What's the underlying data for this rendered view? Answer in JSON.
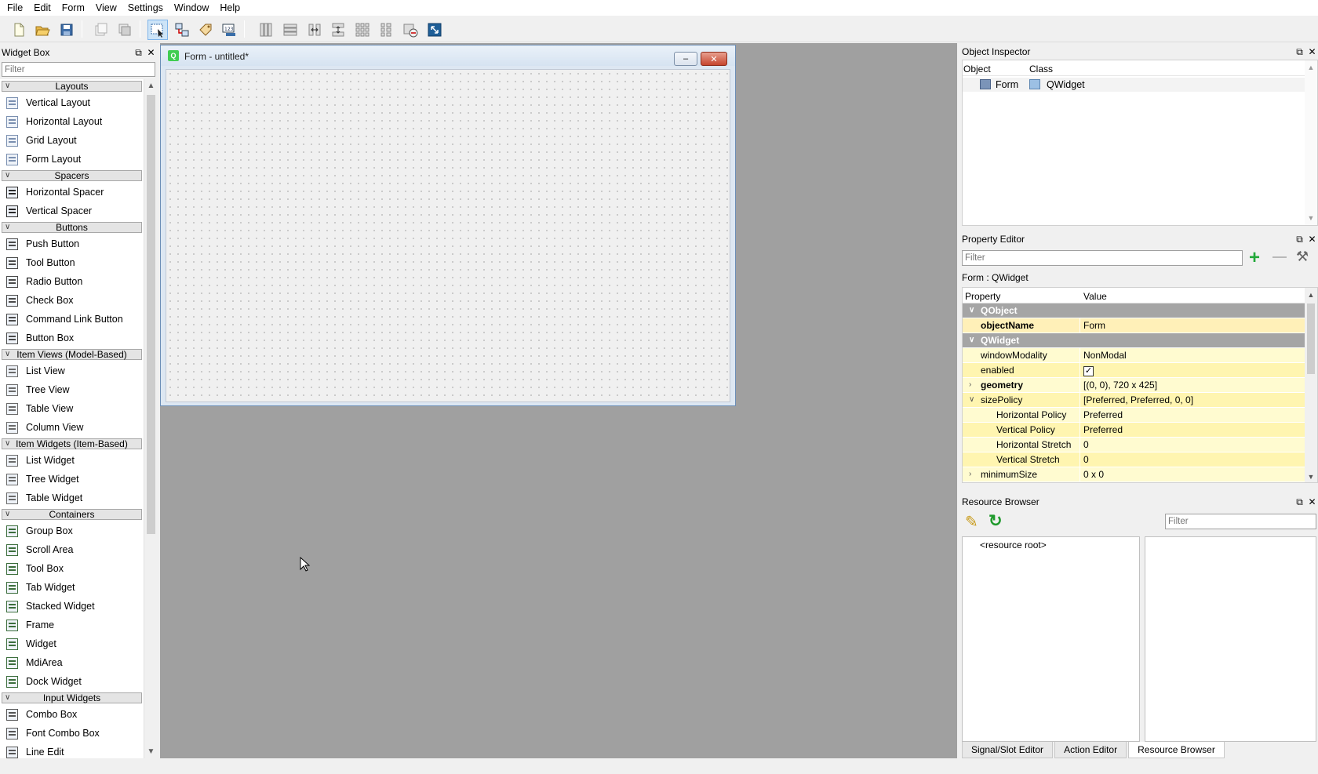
{
  "menu": [
    "File",
    "Edit",
    "Form",
    "View",
    "Settings",
    "Window",
    "Help"
  ],
  "widget_box": {
    "title": "Widget Box",
    "filter_placeholder": "Filter",
    "categories": [
      {
        "name": "Layouts",
        "items": [
          "Vertical Layout",
          "Horizontal Layout",
          "Grid Layout",
          "Form Layout"
        ]
      },
      {
        "name": "Spacers",
        "items": [
          "Horizontal Spacer",
          "Vertical Spacer"
        ]
      },
      {
        "name": "Buttons",
        "items": [
          "Push Button",
          "Tool Button",
          "Radio Button",
          "Check Box",
          "Command Link Button",
          "Button Box"
        ]
      },
      {
        "name": "Item Views (Model-Based)",
        "items": [
          "List View",
          "Tree View",
          "Table View",
          "Column View"
        ]
      },
      {
        "name": "Item Widgets (Item-Based)",
        "items": [
          "List Widget",
          "Tree Widget",
          "Table Widget"
        ]
      },
      {
        "name": "Containers",
        "items": [
          "Group Box",
          "Scroll Area",
          "Tool Box",
          "Tab Widget",
          "Stacked Widget",
          "Frame",
          "Widget",
          "MdiArea",
          "Dock Widget"
        ]
      },
      {
        "name": "Input Widgets",
        "items": [
          "Combo Box",
          "Font Combo Box",
          "Line Edit"
        ]
      }
    ]
  },
  "form_window": {
    "title": "Form - untitled*"
  },
  "object_inspector": {
    "title": "Object Inspector",
    "col_object": "Object",
    "col_class": "Class",
    "row": {
      "object": "Form",
      "class": "QWidget"
    }
  },
  "property_editor": {
    "title": "Property Editor",
    "filter_placeholder": "Filter",
    "context": "Form : QWidget",
    "col_property": "Property",
    "col_value": "Value",
    "rows": [
      {
        "name": "QObject",
        "value": ""
      },
      {
        "name": "objectName",
        "value": "Form"
      },
      {
        "name": "QWidget",
        "value": ""
      },
      {
        "name": "windowModality",
        "value": "NonModal"
      },
      {
        "name": "enabled",
        "value": ""
      },
      {
        "name": "geometry",
        "value": "[(0, 0), 720 x 425]"
      },
      {
        "name": "sizePolicy",
        "value": "[Preferred, Preferred, 0, 0]"
      },
      {
        "name": "Horizontal Policy",
        "value": "Preferred"
      },
      {
        "name": "Vertical Policy",
        "value": "Preferred"
      },
      {
        "name": "Horizontal Stretch",
        "value": "0"
      },
      {
        "name": "Vertical Stretch",
        "value": "0"
      },
      {
        "name": "minimumSize",
        "value": "0 x 0"
      }
    ]
  },
  "resource_browser": {
    "title": "Resource Browser",
    "filter_placeholder": "Filter",
    "root": "<resource root>",
    "tabs": [
      "Signal/Slot Editor",
      "Action Editor",
      "Resource Browser"
    ]
  }
}
